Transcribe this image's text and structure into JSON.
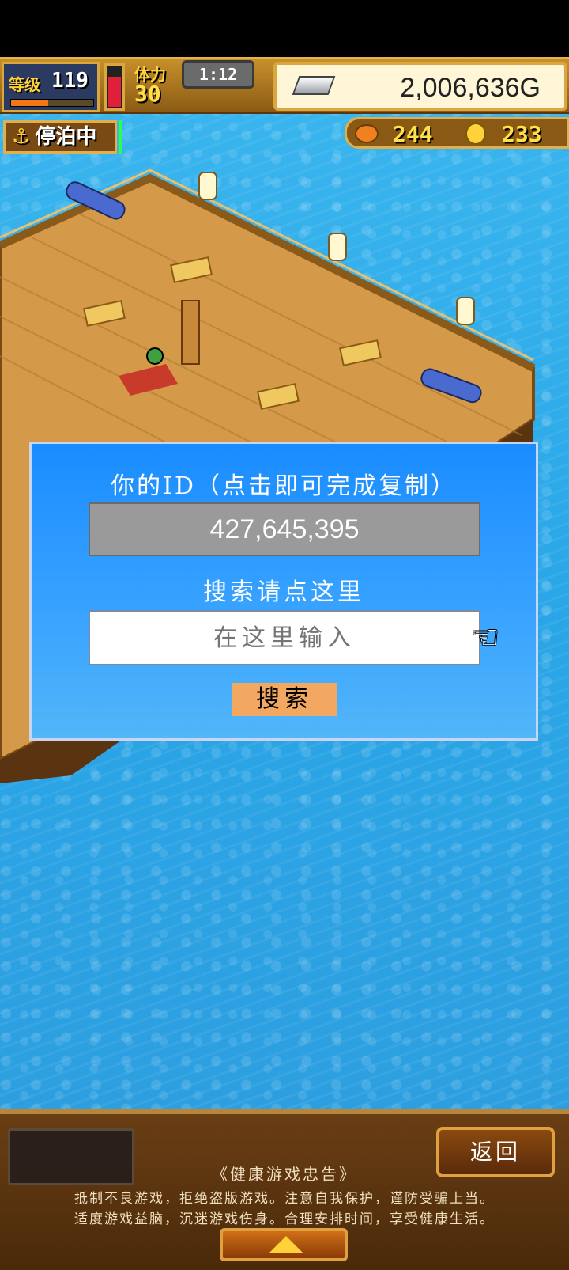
{
  "hud": {
    "level_label": "等级",
    "level_value": "119",
    "exp_progress": 0.45,
    "stamina_label": "体力",
    "stamina_value": "30",
    "stamina_fill": 0.7,
    "timer": "1:12",
    "gold": "2,006,636G",
    "silver_icon": "silver-bar-icon"
  },
  "status": {
    "anchor_label": "停泊中",
    "anchor_icon": "⚓"
  },
  "resources": {
    "wood_value": "244",
    "coin_value": "233"
  },
  "dialog": {
    "title": "你的ID（点击即可完成复制）",
    "id_value": "427,645,395",
    "search_prompt": "搜索请点这里",
    "search_placeholder": "在这里输入",
    "search_button": "搜索",
    "pointer_icon": "☜"
  },
  "bottom": {
    "return_label": "返回",
    "notice_title": "《健康游戏忠告》",
    "notice_line1": "抵制不良游戏，拒绝盗版游戏。注意自我保护，谨防受骗上当。",
    "notice_line2": "适度游戏益脑，沉迷游戏伤身。合理安排时间，享受健康生活。"
  },
  "colors": {
    "dialog_bg": "#1a8cff",
    "ocean": "#2aa7e8",
    "search_button": "#f2a860",
    "hud_gold": "#d9a640"
  }
}
